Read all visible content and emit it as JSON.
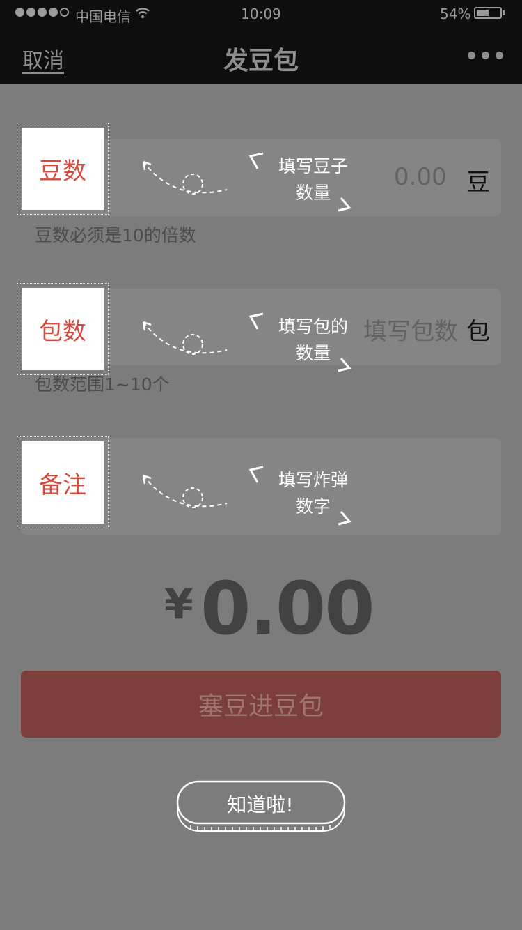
{
  "status_bar": {
    "carrier": "中国电信",
    "time": "10:09",
    "battery_percent": "54%",
    "battery_level": 0.54,
    "signal_bars": 4
  },
  "nav": {
    "cancel": "取消",
    "title": "发豆包",
    "more_icon": "more-dots-icon"
  },
  "rows": [
    {
      "label": "豆数",
      "value": "0.00",
      "unit": "豆",
      "hint": "豆数必须是10的倍数",
      "annotation": [
        "填写豆子",
        "数量"
      ]
    },
    {
      "label": "包数",
      "placeholder": "填写包数",
      "unit": "包",
      "hint": "包数范围1~10个",
      "annotation": [
        "填写包的",
        "数量"
      ]
    },
    {
      "label": "备注",
      "annotation": [
        "填写炸弹",
        "数字"
      ]
    }
  ],
  "amount": {
    "currency": "¥",
    "value": "0.00"
  },
  "submit": "塞豆进豆包",
  "got_it": "知道啦!",
  "colors": {
    "overlay": "#7c7c7c",
    "submit_bg": "#7b3e3b",
    "label_text": "#d24b3f"
  }
}
